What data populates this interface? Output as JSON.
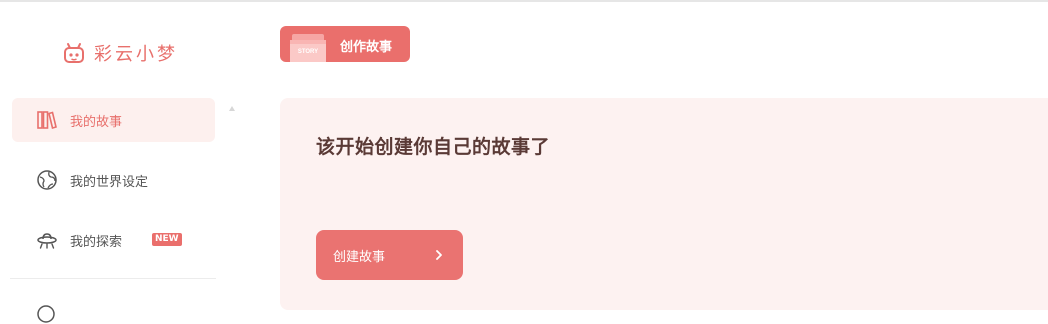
{
  "app": {
    "logo_text": "彩云小梦",
    "logo_icon": "robot-face-icon"
  },
  "sidebar": {
    "items": [
      {
        "label": "我的故事",
        "icon": "bookshelf-icon",
        "active": true
      },
      {
        "label": "我的世界设定",
        "icon": "globe-icon",
        "active": false
      },
      {
        "label": "我的探索",
        "icon": "ufo-icon",
        "active": false,
        "badge": "NEW"
      }
    ]
  },
  "header": {
    "tab_label": "创作故事",
    "tab_image_text": "STORY"
  },
  "main": {
    "title": "该开始创建你自己的故事了",
    "create_button_label": "创建故事",
    "create_button_icon": "chevron-right-icon"
  },
  "colors": {
    "accent": "#ea6f6c",
    "panel_bg": "#fdf2f1",
    "active_nav_bg": "#fdf0ee",
    "title_text": "#5a3a36"
  }
}
